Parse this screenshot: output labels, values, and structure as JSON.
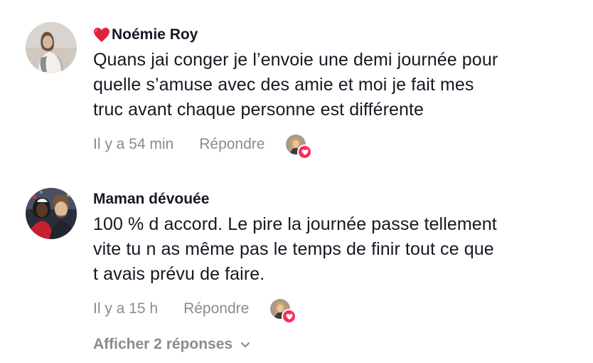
{
  "comments": [
    {
      "username": "Noémie Roy",
      "username_emoji": "red-heart-icon",
      "text": "Quans jai conger je l’envoie une demi journée pour\nquelle s’amuse avec des amie et moi je fait mes\ntruc avant chaque personne est différente",
      "time": "Il y a 54 min",
      "reply_label": "Répondre",
      "liked_by_creator": true
    },
    {
      "username": "Maman dévouée",
      "text": "100 % d accord. Le pire la journée passe tellement\nvite tu n as même pas le temps de finir tout ce que\nt avais prévu de faire.",
      "time": "Il y a 15 h",
      "reply_label": "Répondre",
      "liked_by_creator": true
    }
  ],
  "view_replies_label": "Afficher 2 réponses",
  "colors": {
    "text": "#161823",
    "muted": "#8a8b91",
    "like_badge": "#fe2c55"
  }
}
